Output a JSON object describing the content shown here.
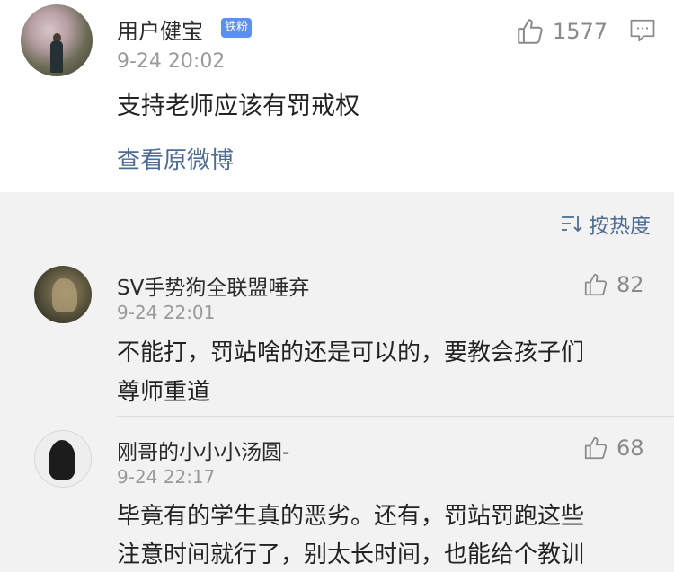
{
  "main_post": {
    "username": "用户健宝",
    "badge": "铁粉",
    "timestamp": "9-24 20:02",
    "text": "支持老师应该有罚戒权",
    "like_count": "1577",
    "view_original": "查看原微博"
  },
  "sort": {
    "label": "按热度",
    "icon": "sort-icon"
  },
  "comments": [
    {
      "username": "SV手势狗全联盟唾弃",
      "timestamp": "9-24 22:01",
      "text_lines": [
        "不能打，罚站啥的还是可以的，要教会孩子们",
        "尊师重道"
      ],
      "like_count": "82"
    },
    {
      "username": "刚哥的小小小汤圆-",
      "timestamp": "9-24 22:17",
      "text_lines": [
        "毕竟有的学生真的恶劣。还有，罚站罚跑这些",
        "注意时间就行了，别太长时间，也能给个教训"
      ],
      "like_count": "68"
    }
  ],
  "colors": {
    "link": "#4e6c93",
    "badge": "#5b8ff0",
    "comments_bg": "#f2f2f2",
    "muted": "#9a9a9a"
  },
  "icons": {
    "like": "thumbs-up-icon",
    "comment": "comment-icon",
    "sort": "sort-icon"
  }
}
